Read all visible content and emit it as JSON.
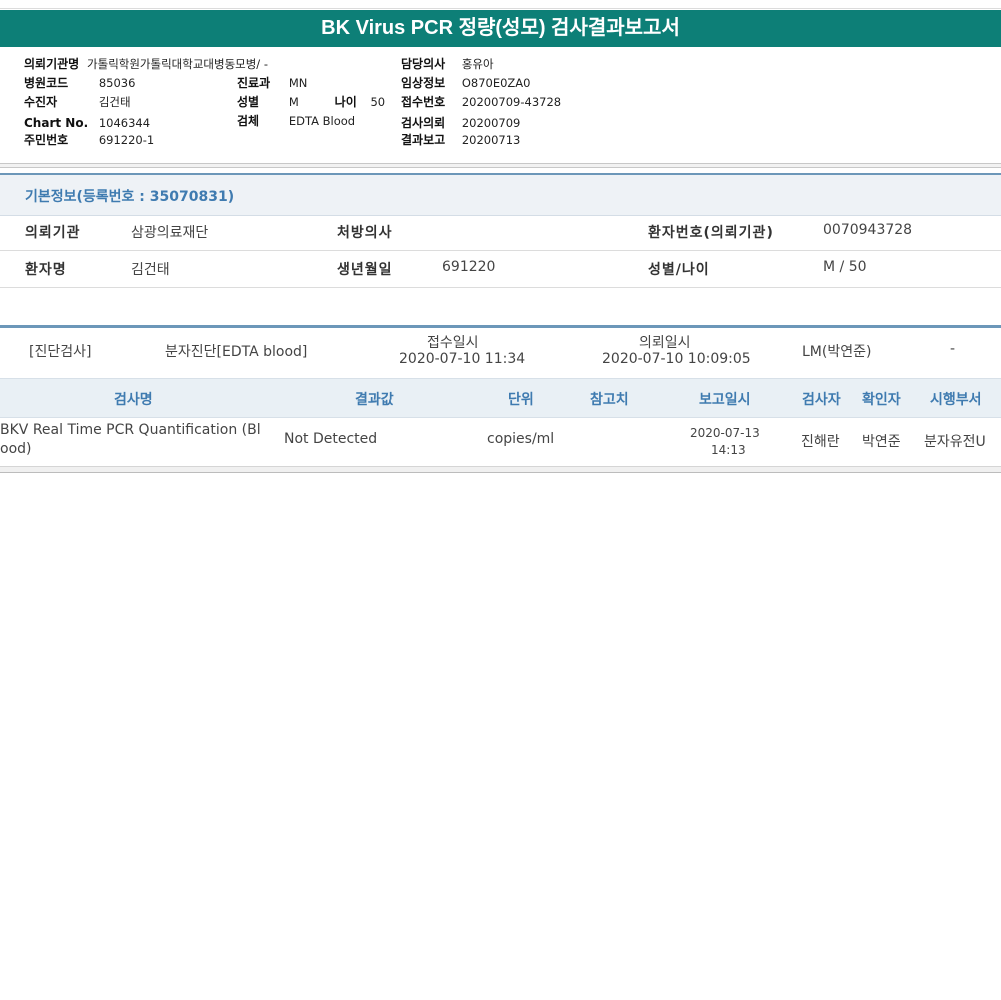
{
  "title": "BK Virus PCR 정량(성모) 검사결과보고서",
  "header": {
    "institution_label": "의뢰기관명",
    "institution_value": "가톨릭학원가톨릭대학교대병동모병/ -",
    "hospital_code_label": "병원코드",
    "hospital_code_value": "85036",
    "recipient_label": "수진자",
    "recipient_value": "김건태",
    "chart_no_label": "Chart No.",
    "chart_no_value": "1046344",
    "resident_no_label": "주민번호",
    "resident_no_value": "691220-1",
    "dept_label": "진료과",
    "dept_value": "MN",
    "sex_label": "성별",
    "sex_value": "M",
    "age_label": "나이",
    "age_value": "50",
    "specimen_label": "검체",
    "specimen_value": "EDTA Blood",
    "doctor_label": "담당의사",
    "doctor_value": "홍유아",
    "clinical_label": "임상정보",
    "clinical_value": "O870E0ZA0",
    "receipt_no_label": "접수번호",
    "receipt_no_value": "20200709-43728",
    "request_label": "검사의뢰",
    "request_value": "20200709",
    "report_label": "결과보고",
    "report_value": "20200713"
  },
  "basic_info": {
    "title": "기본정보(등록번호 : 35070831)",
    "req_inst_label": "의뢰기관",
    "req_inst_value": "삼광의료재단",
    "prescriber_label": "처방의사",
    "prescriber_value": "",
    "patient_no_label": "환자번호(의뢰기관)",
    "patient_no_value": "0070943728",
    "patient_name_label": "환자명",
    "patient_name_value": "김건태",
    "birth_label": "생년월일",
    "birth_value": "691220",
    "sex_age_label": "성별/나이",
    "sex_age_value": "M / 50"
  },
  "diagnosis": {
    "category": "[진단검사]",
    "type": "분자진단[EDTA blood]",
    "receipt_label": "접수일시",
    "receipt_value": "2020-07-10 11:34",
    "request_label": "의뢰일시",
    "request_value": "2020-07-10 10:09:05",
    "lm": "LM(박연준)",
    "dash": "-"
  },
  "table": {
    "headers": {
      "test_name": "검사명",
      "result": "결과값",
      "unit": "단위",
      "reference": "참고치",
      "report_time": "보고일시",
      "examiner": "검사자",
      "confirmer": "확인자",
      "department": "시행부서"
    },
    "rows": [
      {
        "test_name_line1": "BKV Real Time PCR Quantification (Bl",
        "test_name_line2": "ood)",
        "result": "Not Detected",
        "unit": "copies/ml",
        "reference": "",
        "report_date": "2020-07-13",
        "report_time": "14:13",
        "examiner": "진해란",
        "confirmer": "박연준",
        "department": "분자유전U"
      }
    ]
  }
}
